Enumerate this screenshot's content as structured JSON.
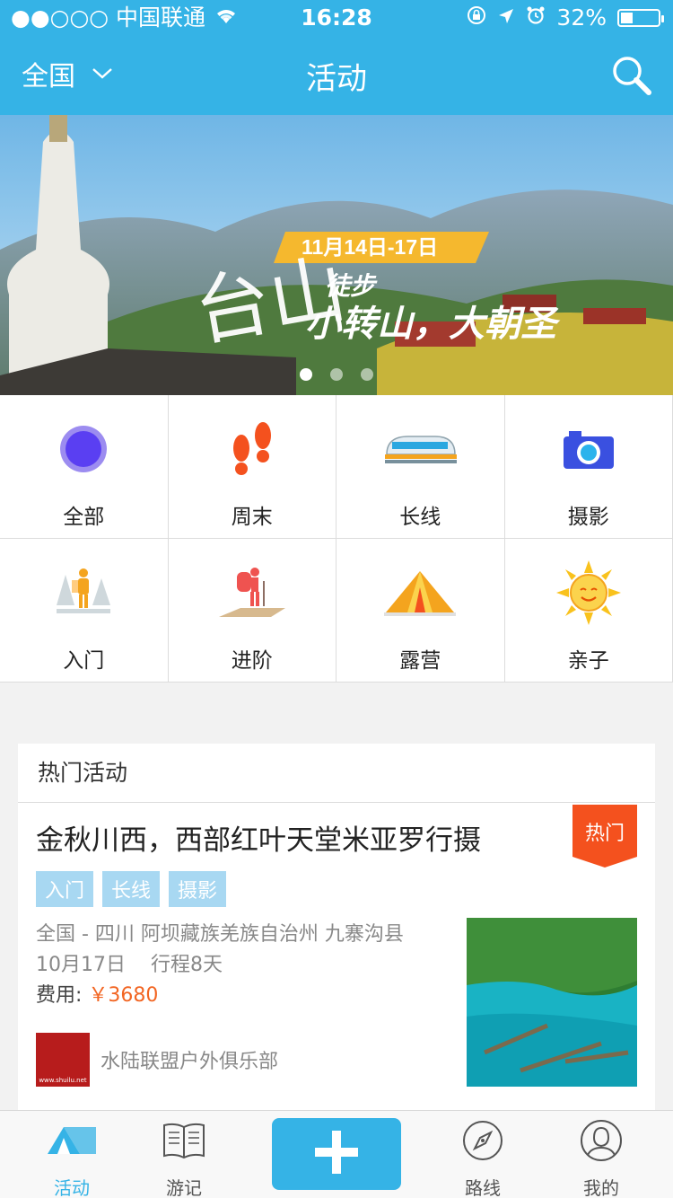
{
  "status_bar": {
    "carrier": "●●○○○ 中国联通",
    "time": "16:28",
    "battery": "32%",
    "battery_level": 0.32
  },
  "nav": {
    "region": "全国",
    "title": "活动"
  },
  "banner": {
    "slogan": "徒步",
    "headline": "小转山，大朝圣",
    "date": "11月14日-17日",
    "page_count": 3,
    "active_page": 1
  },
  "categories": [
    {
      "label": "全部",
      "icon": "all-circle-icon"
    },
    {
      "label": "周末",
      "icon": "footprints-icon"
    },
    {
      "label": "长线",
      "icon": "train-icon"
    },
    {
      "label": "摄影",
      "icon": "camera-icon"
    },
    {
      "label": "入门",
      "icon": "hiker-trees-icon"
    },
    {
      "label": "进阶",
      "icon": "hiker-backpack-icon"
    },
    {
      "label": "露营",
      "icon": "tent-icon"
    },
    {
      "label": "亲子",
      "icon": "smiling-sun-icon"
    }
  ],
  "hot": {
    "section_title": "热门活动",
    "event": {
      "title": "金秋川西，西部红叶天堂米亚罗行摄",
      "badge": "热门",
      "tags": [
        "入门",
        "长线",
        "摄影"
      ],
      "location": "全国 - 四川 阿坝藏族羌族自治州 九寨沟县",
      "date": "10月17日",
      "duration": "行程8天",
      "fee_label": "费用:",
      "price": "￥3680",
      "organizer": "水陆联盟户外俱乐部",
      "organizer_logo_text": "www.shuilu.net"
    }
  },
  "tabbar": {
    "items": [
      {
        "label": "活动",
        "icon": "tent-tab-icon",
        "active": true
      },
      {
        "label": "游记",
        "icon": "book-icon",
        "active": false
      },
      {
        "label": "路线",
        "icon": "compass-icon",
        "active": false
      },
      {
        "label": "我的",
        "icon": "user-icon",
        "active": false
      }
    ],
    "center_button_icon": "plus-icon"
  },
  "colors": {
    "primary": "#35b3e6",
    "accent": "#f26522",
    "tag_bg": "#a8d8f2"
  }
}
